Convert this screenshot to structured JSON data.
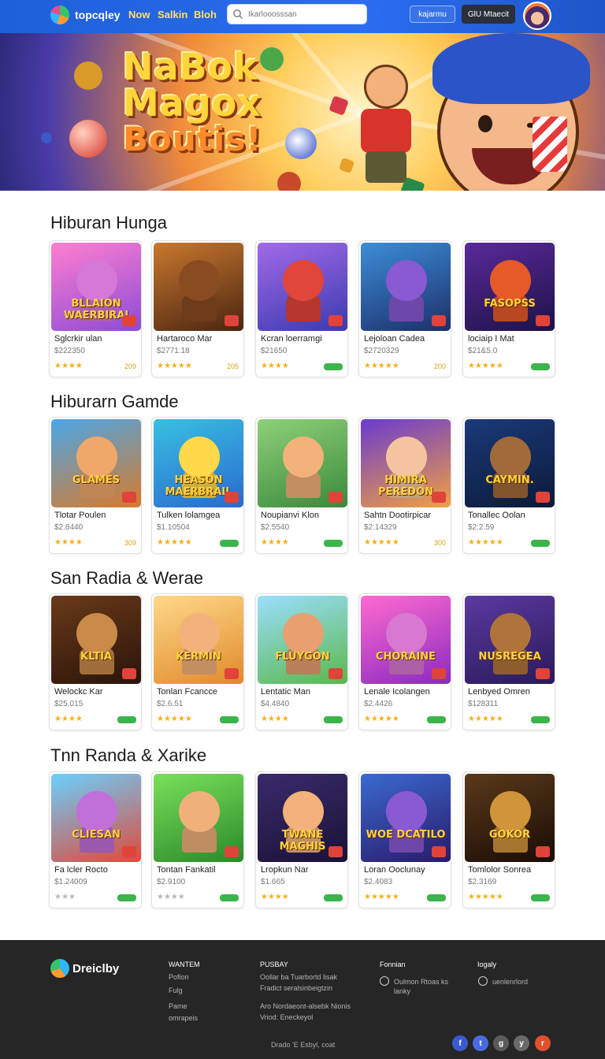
{
  "header": {
    "brand": "topcqley",
    "nav": [
      "Now",
      "Salkin",
      "Bloh"
    ],
    "search_placeholder": "Ikarlooosssan",
    "btn_outline": "kajarmu",
    "btn_dark": "GlU Mtaecit"
  },
  "hero": {
    "title_lines": [
      "NaBok",
      "Magox",
      "Boutis!"
    ]
  },
  "sections": [
    {
      "title": "Hiburan Hunga",
      "cards": [
        {
          "name": "Sglcrkir ulan",
          "price": "$222350",
          "rating": 4,
          "count": "209",
          "badge": "",
          "thumb_text": "BLLAION WAERBIRAI",
          "bg": [
            "#ff7fd0",
            "#8c4bd6"
          ],
          "char": "#d678d8"
        },
        {
          "name": "Hartaroco Mar",
          "price": "$2771:18",
          "rating": 5,
          "count": "205",
          "badge": "",
          "thumb_text": "",
          "bg": [
            "#c9782e",
            "#4a2512"
          ],
          "char": "#8a4a22"
        },
        {
          "name": "Kcran loerramgi",
          "price": "$21650",
          "rating": 4,
          "count": "",
          "badge": "pill",
          "thumb_text": "",
          "bg": [
            "#a26ae8",
            "#3b3bb0"
          ],
          "char": "#e2453a"
        },
        {
          "name": "Lejoloan Cadea",
          "price": "$2720329",
          "rating": 5,
          "count": "200",
          "badge": "",
          "thumb_text": "",
          "bg": [
            "#3c8ed8",
            "#1d2f6a"
          ],
          "char": "#8a5ad2"
        },
        {
          "name": "lociaip I Mat",
          "price": "$21&5.0",
          "rating": 5,
          "count": "",
          "badge": "pill",
          "thumb_text": "FASOPSS",
          "bg": [
            "#5a2a9a",
            "#1d1248"
          ],
          "char": "#e65a2a"
        }
      ]
    },
    {
      "title": "Hiburarn Gamde",
      "cards": [
        {
          "name": "Tlotar Poulen",
          "price": "$2.8440",
          "rating": 4,
          "count": "309",
          "badge": "",
          "thumb_text": "GLAMES",
          "bg": [
            "#4aa6e8",
            "#d97a2a"
          ],
          "char": "#f0a86a"
        },
        {
          "name": "Tulken lolamgea",
          "price": "$1.10504",
          "rating": 5,
          "count": "",
          "badge": "pill",
          "thumb_text": "HEASON MAERBRAIL",
          "bg": [
            "#38c0e0",
            "#2a6ad0"
          ],
          "char": "#ffd94a"
        },
        {
          "name": "Noupianvi Klon",
          "price": "$2.5540",
          "rating": 4,
          "count": "",
          "badge": "pill",
          "thumb_text": "",
          "bg": [
            "#8fd07a",
            "#3a8a3a"
          ],
          "char": "#f2b27a"
        },
        {
          "name": "Sahtn Dootirpicar",
          "price": "$2:14329",
          "rating": 5,
          "count": "300",
          "badge": "",
          "thumb_text": "HIMIRA PEREDON",
          "bg": [
            "#6a3ad0",
            "#f0a040"
          ],
          "char": "#f4c4a0"
        },
        {
          "name": "Tonallec Oolan",
          "price": "$2:2.59",
          "rating": 5,
          "count": "",
          "badge": "pill",
          "thumb_text": "CAYMIN.",
          "bg": [
            "#1a3a7a",
            "#0c1a38"
          ],
          "char": "#a06a3a"
        }
      ]
    },
    {
      "title": "San Radia & Werae",
      "cards": [
        {
          "name": "Welockc Kar",
          "price": "$25.015",
          "rating": 4,
          "count": "",
          "badge": "pill",
          "thumb_text": "KLTIA",
          "bg": [
            "#6a3a1a",
            "#2a140a"
          ],
          "char": "#c98a4a"
        },
        {
          "name": "Tonlan Fcancce",
          "price": "$2.6.51",
          "rating": 5,
          "count": "",
          "badge": "pill",
          "thumb_text": "KERMIN",
          "bg": [
            "#ffd88a",
            "#e08a2a"
          ],
          "char": "#f2b27a"
        },
        {
          "name": "Lentatic Man",
          "price": "$4.4840",
          "rating": 4,
          "count": "",
          "badge": "pill",
          "thumb_text": "FLUYGON",
          "bg": [
            "#9adfff",
            "#5ab84a"
          ],
          "char": "#e8a070"
        },
        {
          "name": "Lenale Icolangen",
          "price": "$2.4426",
          "rating": 5,
          "count": "",
          "badge": "pill",
          "thumb_text": "CHORAINE",
          "bg": [
            "#ff6ad0",
            "#8a2ac0"
          ],
          "char": "#d878d0"
        },
        {
          "name": "Lenbyed Omren",
          "price": "$128311",
          "rating": 5,
          "count": "",
          "badge": "pill",
          "thumb_text": "NUSREGEA",
          "bg": [
            "#5a3aa0",
            "#2a1a5a"
          ],
          "char": "#b0743a"
        }
      ]
    },
    {
      "title": "Tnn Randa & Xarike",
      "cards": [
        {
          "name": "Fa lcler Rocto",
          "price": "$1.24009",
          "rating": 3,
          "count": "",
          "badge": "pill",
          "gray_stars": true,
          "thumb_text": "CLIESAN",
          "bg": [
            "#6ad0ff",
            "#e04a3a"
          ],
          "char": "#c070d8"
        },
        {
          "name": "Tontan Fankatil",
          "price": "$2.9100",
          "rating": 4,
          "count": "",
          "badge": "pill",
          "gray_stars": true,
          "thumb_text": "",
          "bg": [
            "#7ae05a",
            "#2a8a2a"
          ],
          "char": "#f0b07a"
        },
        {
          "name": "Lropkun Nar",
          "price": "$1.665",
          "rating": 4,
          "count": "",
          "badge": "pill",
          "thumb_text": "TWANE MAGHIS",
          "bg": [
            "#3a2a6a",
            "#1a1238"
          ],
          "char": "#f2b27a"
        },
        {
          "name": "Loran Ooclunay",
          "price": "$2.4083",
          "rating": 5,
          "count": "",
          "badge": "pill",
          "thumb_text": "WOE DCATILO",
          "bg": [
            "#3a6ad0",
            "#2a1a6a"
          ],
          "char": "#8a5ad2"
        },
        {
          "name": "Tomlolor Sonrea",
          "price": "$2.3169",
          "rating": 5,
          "count": "",
          "badge": "pill",
          "thumb_text": "GOKOR",
          "bg": [
            "#5a3a1a",
            "#1a0c06"
          ],
          "char": "#d0943a"
        }
      ]
    }
  ],
  "footer": {
    "brand": "Dreiclby",
    "col1_head": "WANTEM",
    "col1_links": [
      "Pofion",
      "Fulg",
      "Pame",
      "omrapeis"
    ],
    "col2_head": "PUSBAY",
    "col2_links": [
      "Oollar ba Tuarbortd lisak",
      "Fradict seralsinbeigtzin",
      "Aro Nordaeont-alsebk Nionis",
      "Vriod: Eneckeyol"
    ],
    "col3_head": "Fonnian",
    "col3_link": "Oulmon Rtoas ks lanky",
    "col4_head": "Iogaly",
    "col4_link": "uenlenrlord",
    "copyright": "Drado 'E Esbyl, coat",
    "social": [
      "f",
      "t",
      "g",
      "y",
      "r"
    ],
    "social_colors": [
      "#3a5ad0",
      "#4a6ae0",
      "#5a5a5a",
      "#6a6a6a",
      "#e0502a"
    ]
  }
}
